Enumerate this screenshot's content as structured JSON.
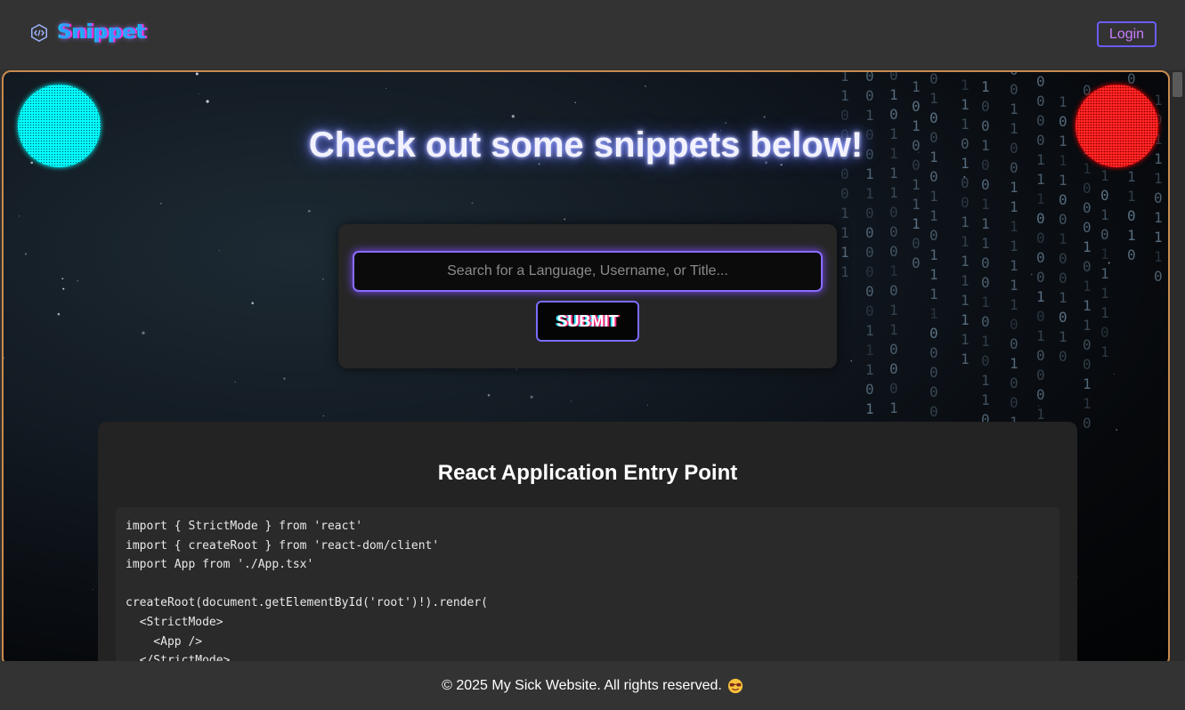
{
  "header": {
    "brand": "Snippet",
    "logo_icon": "code-cube-icon",
    "login_label": "Login"
  },
  "hero": {
    "title": "Check out some snippets below!"
  },
  "search": {
    "placeholder": "Search for a Language, Username, or Title...",
    "value": "",
    "submit_label": "SUBMIT"
  },
  "snippets": [
    {
      "title": "React Application Entry Point",
      "code": "import { StrictMode } from 'react'\nimport { createRoot } from 'react-dom/client'\nimport App from './App.tsx'\n\ncreateRoot(document.getElementById('root')!).render(\n  <StrictMode>\n    <App />\n  </StrictMode>,\n)"
    }
  ],
  "footer": {
    "text": "© 2025 My Sick Website. All rights reserved.",
    "emoji_icon": "star-struck-sunglasses-emoji-icon"
  },
  "colors": {
    "accent_purple": "#7a6cff",
    "stage_border": "#c98a4e",
    "orb_left": "#00ffff",
    "orb_right": "#ff0000"
  }
}
